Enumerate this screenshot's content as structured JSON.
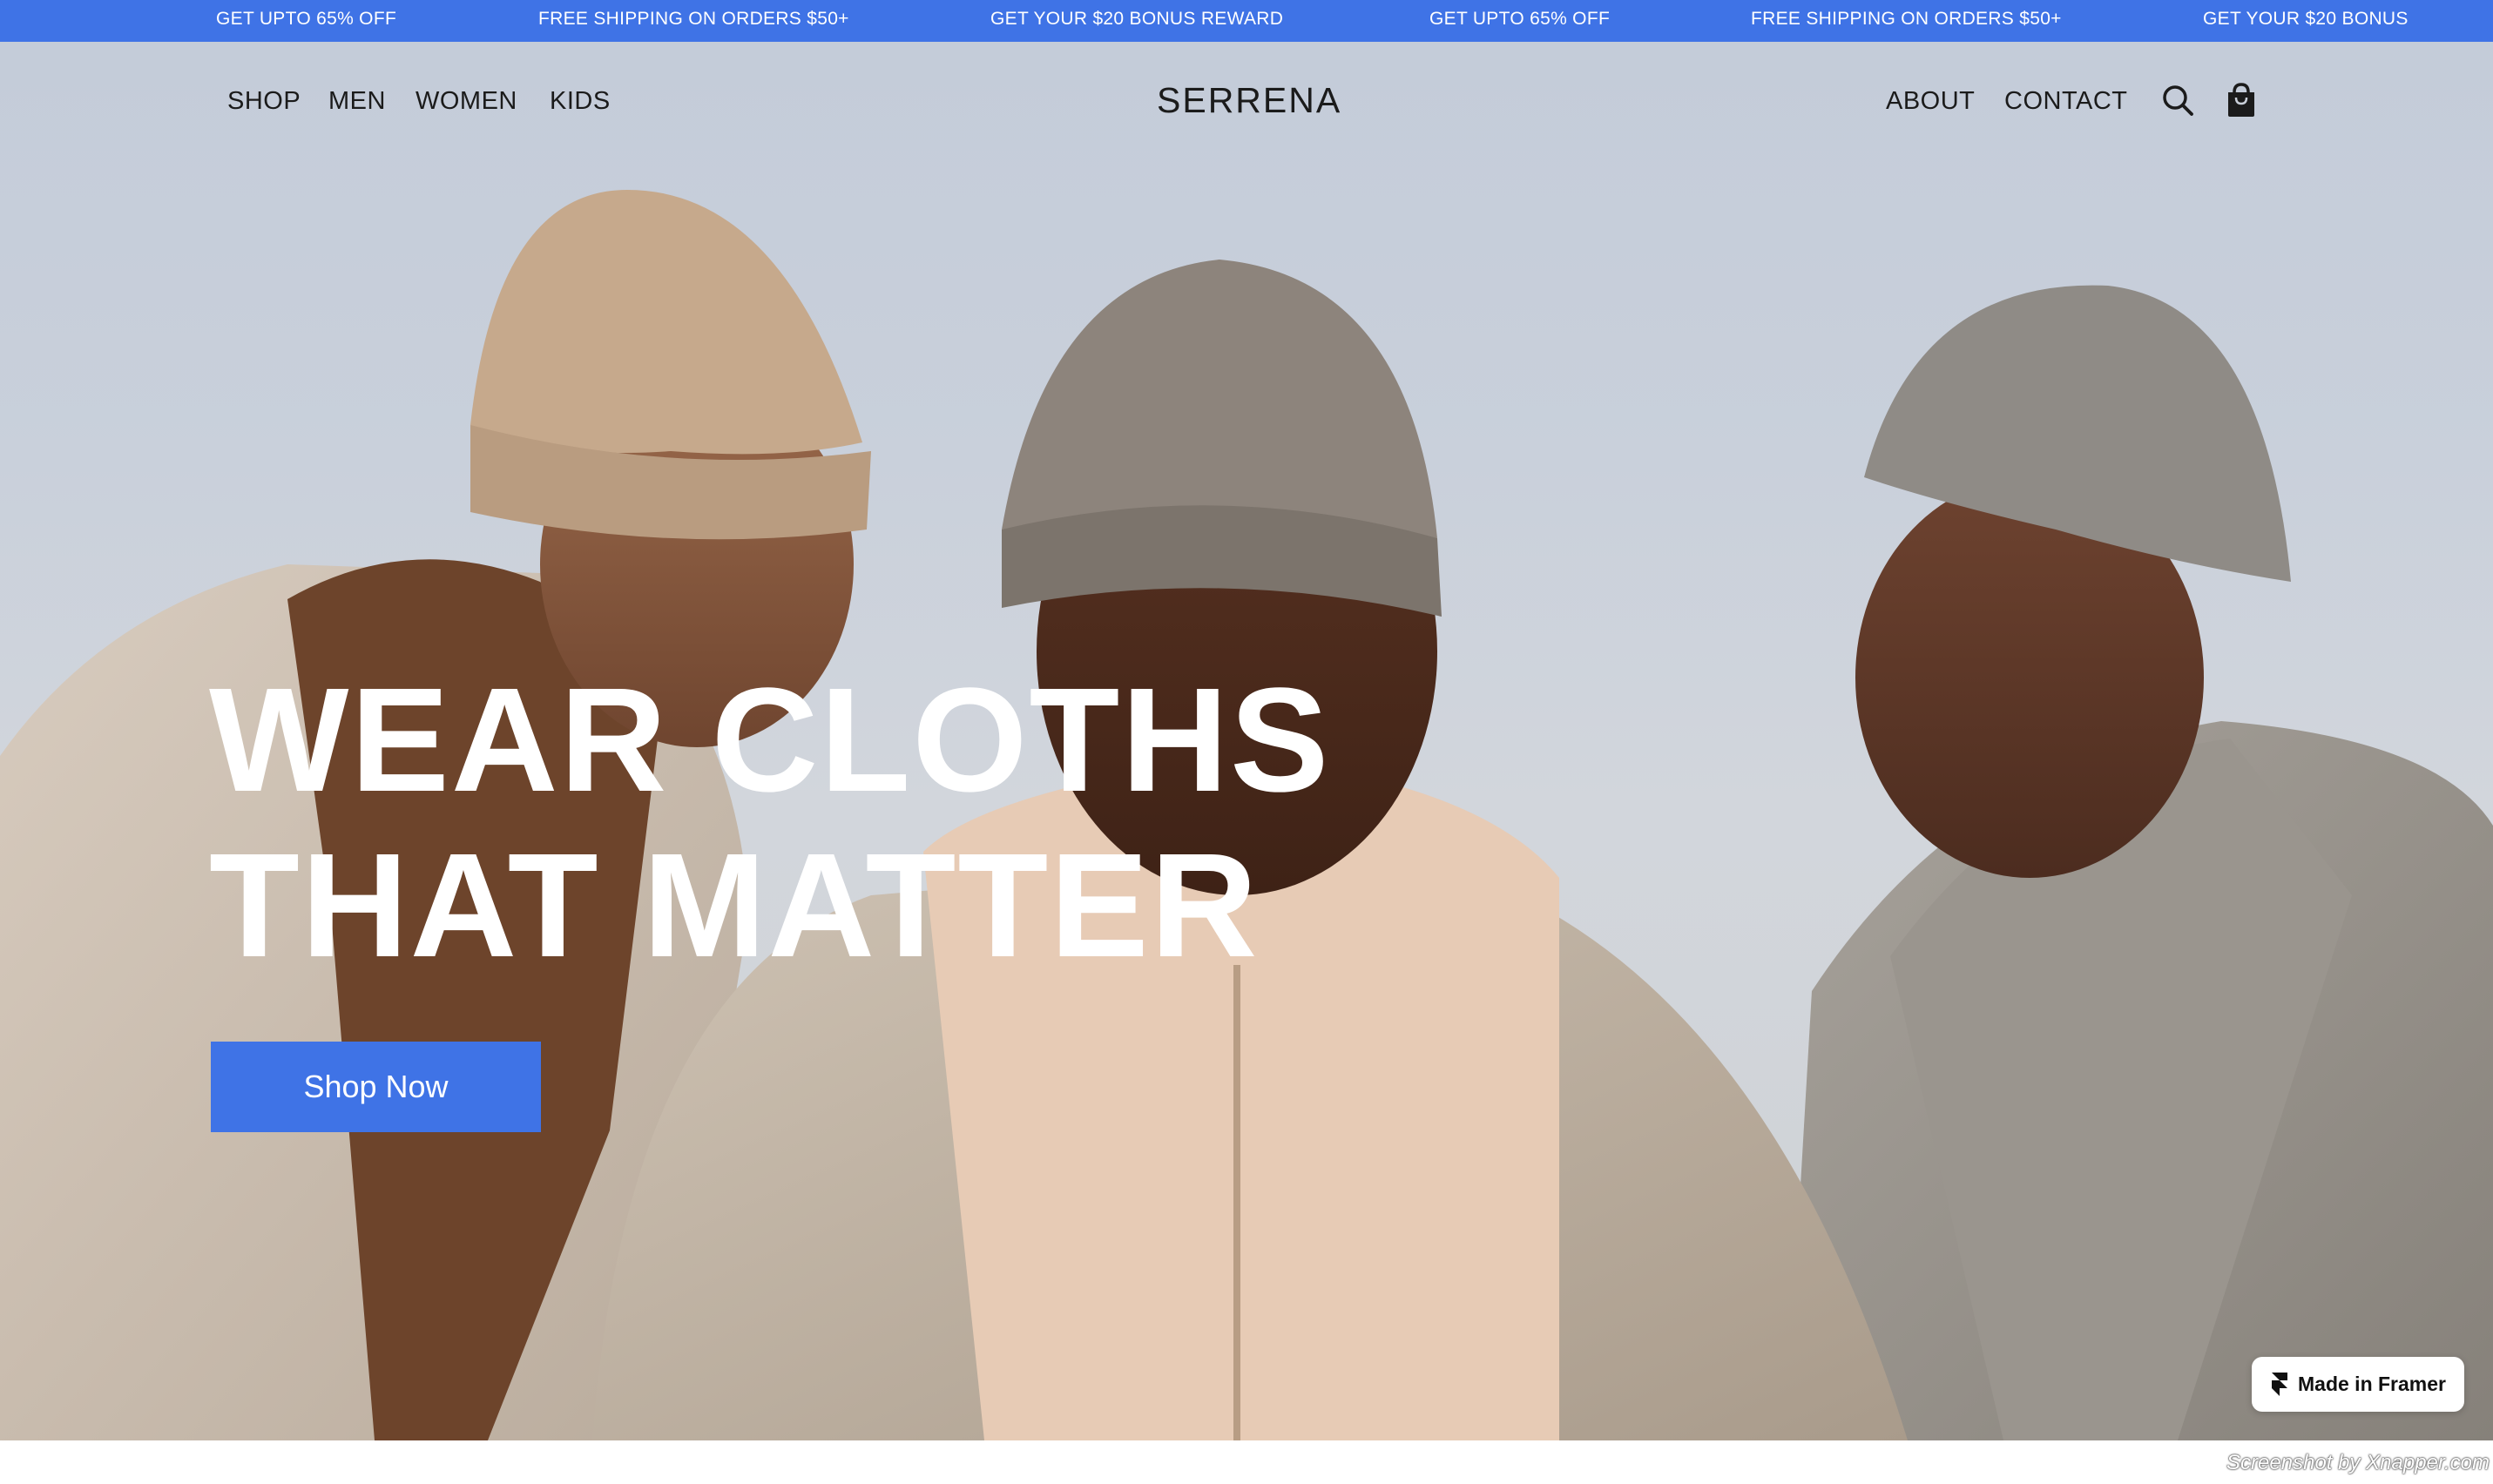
{
  "announcement": {
    "items": [
      "GET UPTO 65% OFF",
      "FREE SHIPPING ON ORDERS $50+",
      "GET YOUR $20 BONUS REWARD",
      "GET UPTO 65% OFF",
      "FREE SHIPPING ON ORDERS $50+",
      "GET YOUR $20 BONUS"
    ],
    "background": "#3f73e6"
  },
  "nav": {
    "left_links": [
      "SHOP",
      "MEN",
      "WOMEN",
      "KIDS"
    ],
    "brand": "SERRENA",
    "right_links": [
      "ABOUT",
      "CONTACT"
    ],
    "icons": [
      "search-icon",
      "shopping-bag-icon"
    ]
  },
  "hero": {
    "headline_line1": "WEAR CLOTHS",
    "headline_line2": "THAT MATTER",
    "cta_label": "Shop Now",
    "accent": "#3f73e6"
  },
  "badge": {
    "label": "Made in Framer",
    "icon": "framer-logo-icon"
  },
  "watermark": "Screenshot by Xnapper.com"
}
